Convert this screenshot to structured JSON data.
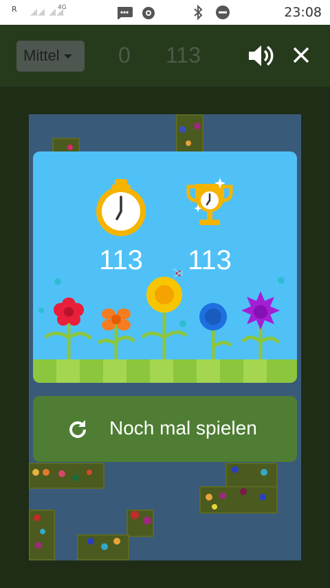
{
  "status_bar": {
    "carrier_letter": "R",
    "network": "4G",
    "time": "23:08",
    "icons": [
      "signal-icon",
      "message-icon",
      "record-icon",
      "bluetooth-icon",
      "do-not-disturb-icon"
    ]
  },
  "game_bar": {
    "difficulty": "Mittel",
    "score_current": "0",
    "score_best": "113",
    "icons": [
      "volume-icon",
      "close-icon"
    ]
  },
  "result_card": {
    "time_value": "113",
    "best_value": "113",
    "icons": [
      "stopwatch-icon",
      "trophy-icon"
    ]
  },
  "replay_button": {
    "label": "Noch mal spielen",
    "icon": "refresh-icon"
  },
  "colors": {
    "card_bg": "#4fc1f7",
    "button_bg": "#4e7d33",
    "grass": "#8cc63f",
    "board_water": "#3a5a7a"
  }
}
